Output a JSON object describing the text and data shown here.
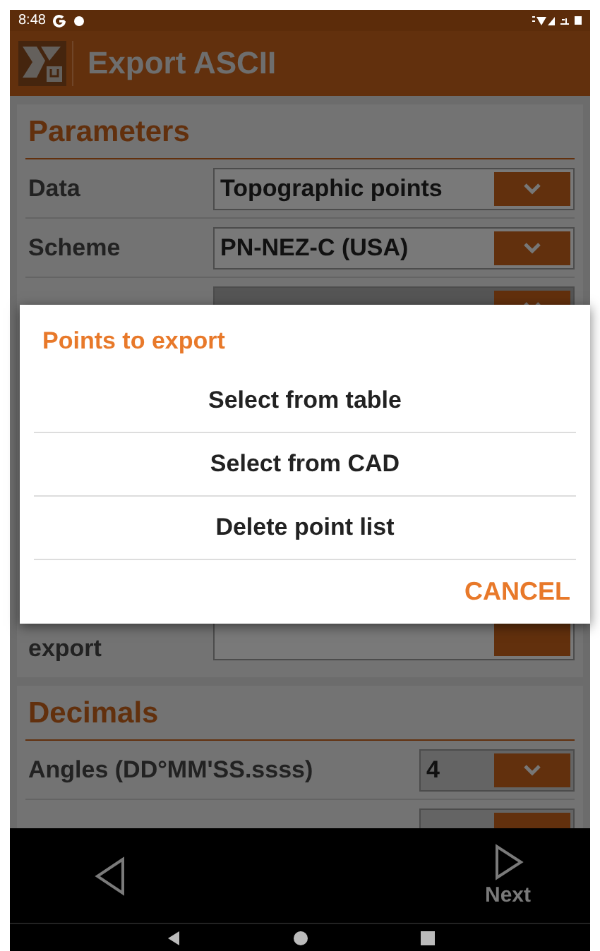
{
  "status_bar": {
    "time": "8:48"
  },
  "app_bar": {
    "title": "Export ASCII"
  },
  "parameters": {
    "title": "Parameters",
    "rows": [
      {
        "label": "Data",
        "value": "Topographic points"
      },
      {
        "label": "Scheme",
        "value": "PN-NEZ-C (USA)"
      }
    ],
    "covered_label": "export"
  },
  "decimals": {
    "title": "Decimals",
    "rows": [
      {
        "label": "Angles (DD°MM'SS.ssss)",
        "value": "4"
      }
    ]
  },
  "dialog": {
    "title": "Points to export",
    "options": [
      "Select from table",
      "Select from CAD",
      "Delete point list"
    ],
    "cancel": "CANCEL"
  },
  "bottom_nav": {
    "next": "Next"
  }
}
